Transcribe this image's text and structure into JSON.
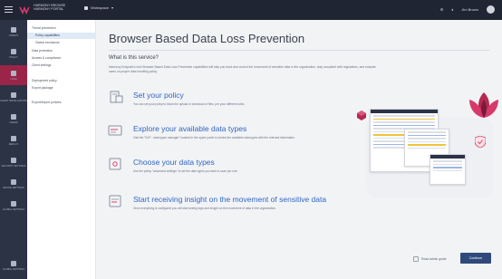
{
  "topbar": {
    "brand_line1": "HARMONY BROWSE",
    "brand_line2": "HARMONY PORTAL",
    "workspace": "Workspace",
    "user": "Jim Brown"
  },
  "rail": [
    {
      "label": "ASSETS",
      "icon": "grid-icon"
    },
    {
      "label": "POLICY",
      "icon": "policy-icon"
    },
    {
      "label": "LOGS",
      "icon": "logs-icon"
    },
    {
      "label": "CLIENT INSTALLATIONS",
      "icon": "client-icon"
    },
    {
      "label": "USERS",
      "icon": "users-icon"
    },
    {
      "label": "DEPLOY",
      "icon": "deploy-icon"
    },
    {
      "label": "SECURITY SETTINGS",
      "icon": "security-icon"
    },
    {
      "label": "DEVICE SETTINGS",
      "icon": "device-icon"
    },
    {
      "label": "GLOBAL SETTINGS",
      "icon": "settings-icon"
    }
  ],
  "rail_bottom": {
    "label": "GLOBAL SETTINGS"
  },
  "subnav": [
    {
      "label": "Threat prevention",
      "active": false
    },
    {
      "label": "Policy capabilities",
      "active": true
    },
    {
      "label": "Global exclusions",
      "active": false
    },
    {
      "label": "Data protection",
      "active": false
    },
    {
      "label": "Access & compliance",
      "active": false
    },
    {
      "label": "Client settings",
      "active": false
    },
    {
      "label": "Deployment policy",
      "active": false
    },
    {
      "label": "Export package",
      "active": false
    },
    {
      "label": "Export/Import policies",
      "active": false
    }
  ],
  "main": {
    "title": "Browser Based Data Loss Prevention",
    "subtitle": "What is this service?",
    "intro": "Harmony Endpoint's new Browser Based Data Loss Prevention capabilities will help you track and control the movement of sensitive data in the organization, stay compliant with regulations, and educate users on proper data handling policy.",
    "features": [
      {
        "title": "Set your policy",
        "desc": "You can set your policy to block the upload or download of files, per your different rules.",
        "icon": "policy-doc-icon"
      },
      {
        "title": "Explore your available data types",
        "desc": "Visit the \"DLP - data types manager\" located in the upper panel to review the available data types with the relevant information.",
        "icon": "data-types-icon"
      },
      {
        "title": "Choose your data types",
        "desc": "Use the policy \"advanced settings\" to set the data types you wish to scan per rule.",
        "icon": "settings-doc-icon"
      },
      {
        "title": "Start receiving insight on the movement of sensitive data",
        "desc": "Once everything is configured you will start seeing logs and insight on the movement of data in the organization.",
        "icon": "insight-icon"
      }
    ]
  },
  "actions": {
    "guide": "Read admin guide",
    "continue": "Continue"
  },
  "colors": {
    "accent": "#2f66c4",
    "rail_active": "#9b2449",
    "topbar": "#1f2533"
  }
}
